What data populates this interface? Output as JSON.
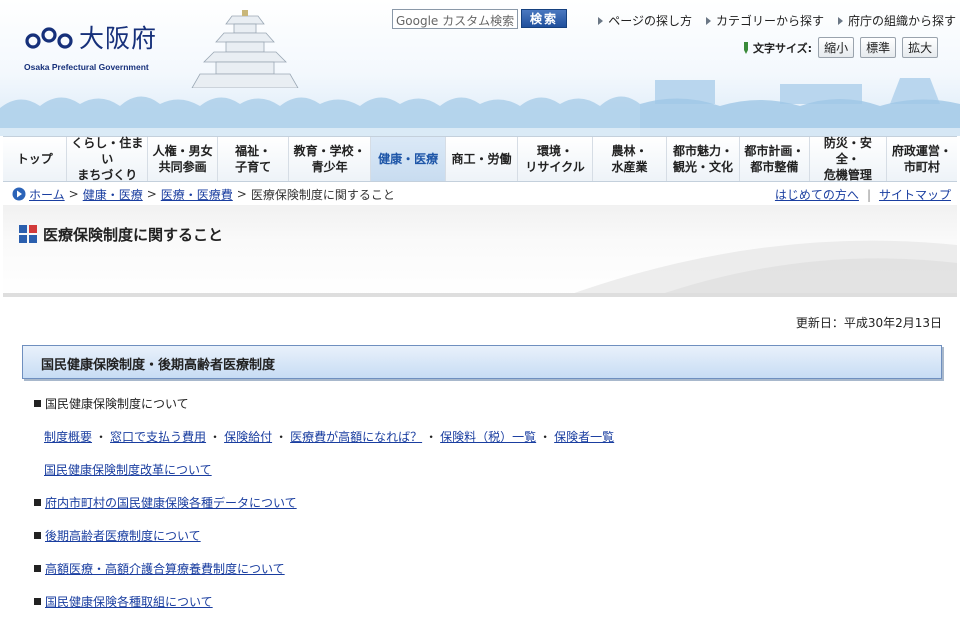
{
  "header": {
    "logo_name": "大阪府",
    "logo_en": "Osaka Prefectural Government",
    "search_placeholder": "Google カスタム検索",
    "search_button": "検索",
    "top_links": [
      "ページの探し方",
      "カテゴリーから探す",
      "府庁の組織から探す"
    ],
    "font_size_label": "文字サイズ:",
    "font_size_buttons": [
      "縮小",
      "標準",
      "拡大"
    ]
  },
  "nav": {
    "items": [
      "トップ",
      "くらし・住まい\nまちづくり",
      "人権・男女\n共同参画",
      "福祉・\n子育て",
      "教育・学校・\n青少年",
      "健康・医療",
      "商工・労働",
      "環境・\nリサイクル",
      "農林・\n水産業",
      "都市魅力・\n観光・文化",
      "都市計画・\n都市整備",
      "防災・安全・\n危機管理",
      "府政運営・\n市町村"
    ],
    "active_index": 5
  },
  "breadcrumb": {
    "items": [
      "ホーム",
      "健康・医療",
      "医療・医療費"
    ],
    "current": "医療保険制度に関すること",
    "separator": ">",
    "util_links": [
      "はじめての方へ",
      "サイトマップ"
    ]
  },
  "page": {
    "title": "医療保険制度に関すること",
    "updated": "更新日：平成30年2月13日",
    "section_heading": "国民健康保険制度・後期高齢者医療制度"
  },
  "content": {
    "item1_label": "国民健康保険制度について",
    "sublinks": [
      "制度概要",
      "窓口で支払う費用",
      "保険給付",
      "医療費が高額になれば？",
      "保険料（税）一覧",
      "保険者一覧"
    ],
    "reform_link": "国民健康保険制度改革について",
    "links": [
      "府内市町村の国民健康保険各種データについて",
      "後期高齢者医療制度について",
      "高額医療・高額介護合算療養費制度について",
      "国民健康保険各種取組について"
    ]
  },
  "colors": {
    "brand_navy": "#16307a",
    "link_blue": "#1a3ea0",
    "nav_active": "#1e56a8",
    "section_bar": "#c7dcf4"
  },
  "icons": {
    "home": "home-circle-arrow-icon",
    "title": "four-squares-icon",
    "top_link_marker": "triangle-right-icon",
    "font_size": "pen-icon"
  }
}
